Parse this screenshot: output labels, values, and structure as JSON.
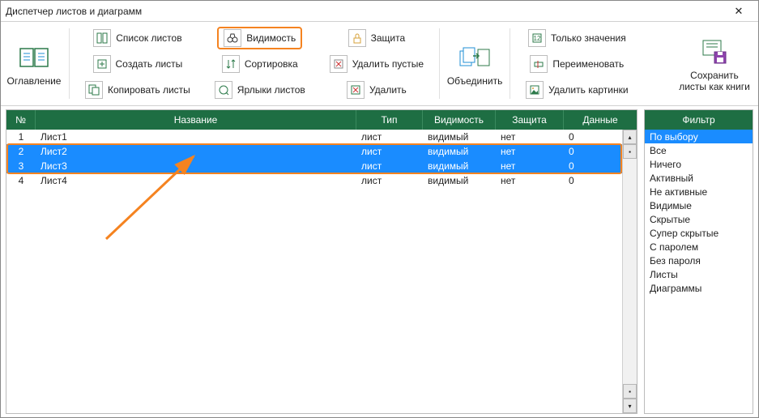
{
  "window": {
    "title": "Диспетчер листов и диаграмм"
  },
  "ribbon": {
    "big1": {
      "label": "Оглавление"
    },
    "big2": {
      "label": "Объединить"
    },
    "big3": {
      "label": "Сохранить\nлисты как книги"
    },
    "g1": {
      "a": "Список листов",
      "b": "Создать листы",
      "c": "Копировать листы"
    },
    "g2": {
      "a": "Видимость",
      "b": "Сортировка",
      "c": "Ярлыки листов"
    },
    "g3": {
      "a": "Защита",
      "b": "Удалить пустые",
      "c": "Удалить"
    },
    "g4": {
      "a": "Только значения",
      "b": "Переименовать",
      "c": "Удалить картинки"
    }
  },
  "table": {
    "headers": {
      "n": "№",
      "name": "Название",
      "type": "Тип",
      "vis": "Видимость",
      "prot": "Защита",
      "data": "Данные"
    },
    "rows": [
      {
        "n": "1",
        "name": "Лист1",
        "type": "лист",
        "vis": "видимый",
        "prot": "нет",
        "data": "0",
        "sel": false
      },
      {
        "n": "2",
        "name": "Лист2",
        "type": "лист",
        "vis": "видимый",
        "prot": "нет",
        "data": "0",
        "sel": true
      },
      {
        "n": "3",
        "name": "Лист3",
        "type": "лист",
        "vis": "видимый",
        "prot": "нет",
        "data": "0",
        "sel": true
      },
      {
        "n": "4",
        "name": "Лист4",
        "type": "лист",
        "vis": "видимый",
        "prot": "нет",
        "data": "0",
        "sel": false
      }
    ]
  },
  "filter": {
    "header": "Фильтр",
    "items": [
      {
        "label": "По выбору",
        "sel": true
      },
      {
        "label": "Все",
        "sel": false
      },
      {
        "label": "Ничего",
        "sel": false
      },
      {
        "label": "Активный",
        "sel": false
      },
      {
        "label": "Не активные",
        "sel": false
      },
      {
        "label": "Видимые",
        "sel": false
      },
      {
        "label": "Скрытые",
        "sel": false
      },
      {
        "label": "Супер скрытые",
        "sel": false
      },
      {
        "label": "С паролем",
        "sel": false
      },
      {
        "label": "Без пароля",
        "sel": false
      },
      {
        "label": "Листы",
        "sel": false
      },
      {
        "label": "Диаграммы",
        "sel": false
      }
    ]
  }
}
